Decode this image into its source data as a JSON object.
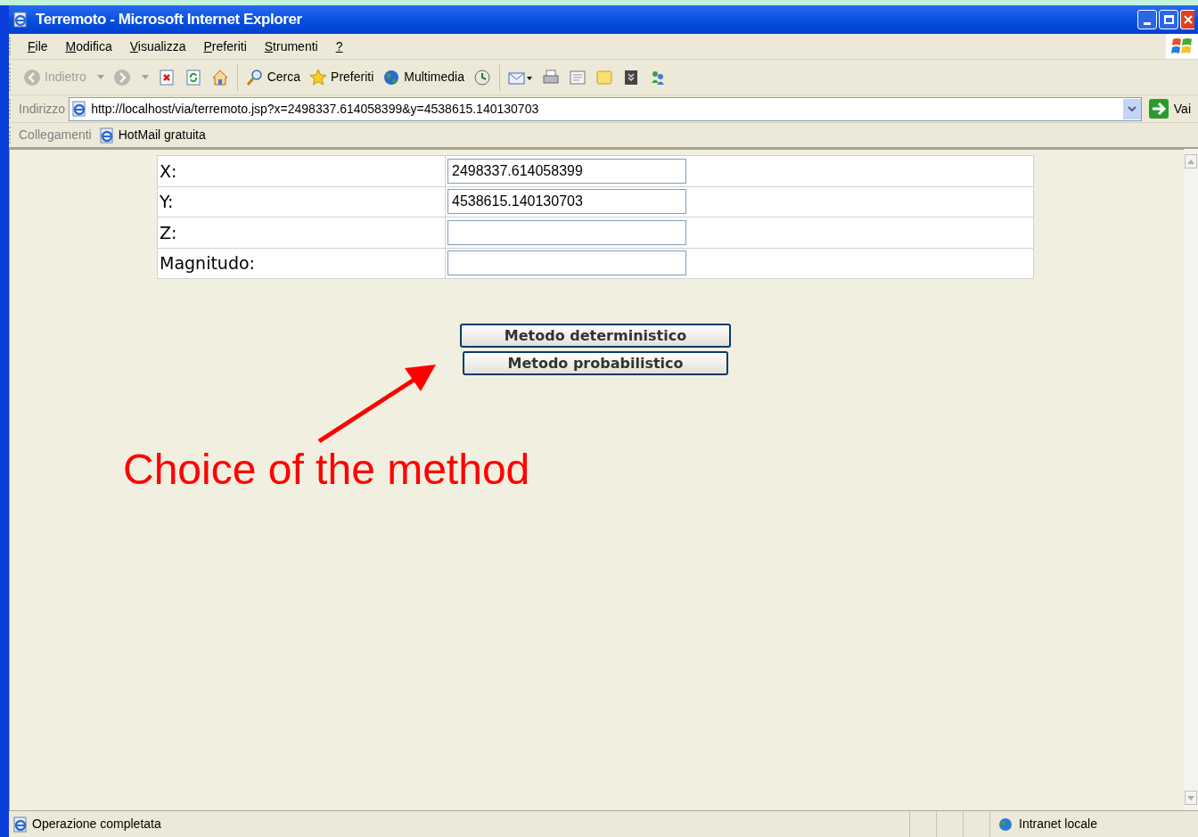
{
  "window": {
    "title": "Terremoto - Microsoft Internet Explorer"
  },
  "menu": [
    "File",
    "Modifica",
    "Visualizza",
    "Preferiti",
    "Strumenti",
    "?"
  ],
  "toolbar": [
    {
      "kind": "back",
      "label": "Indietro",
      "disabled": true
    },
    {
      "kind": "forward",
      "disabled": true
    },
    {
      "kind": "stop",
      "disabled": false
    },
    {
      "kind": "refresh",
      "disabled": false
    },
    {
      "kind": "home",
      "disabled": false
    },
    {
      "kind": "separator"
    },
    {
      "kind": "search",
      "label": "Cerca",
      "disabled": false
    },
    {
      "kind": "favorites",
      "label": "Preferiti",
      "disabled": false
    },
    {
      "kind": "media",
      "label": "Multimedia",
      "disabled": false
    },
    {
      "kind": "history",
      "disabled": false
    },
    {
      "kind": "separator"
    },
    {
      "kind": "mail",
      "disabled": false
    },
    {
      "kind": "print",
      "disabled": false
    },
    {
      "kind": "edit",
      "disabled": false
    },
    {
      "kind": "note",
      "disabled": false
    },
    {
      "kind": "research",
      "disabled": false
    },
    {
      "kind": "messenger",
      "disabled": false
    }
  ],
  "address": {
    "label": "Indirizzo",
    "url": "http://localhost/via/terremoto.jsp?x=2498337.614058399&y=4538615.140130703",
    "go": "Vai"
  },
  "links": {
    "label": "Collegamenti",
    "items": [
      "HotMail gratuita"
    ]
  },
  "form": {
    "fields": [
      {
        "label": "X:",
        "value": "2498337.614058399"
      },
      {
        "label": "Y:",
        "value": "4538615.140130703"
      },
      {
        "label": "Z:"
      },
      {
        "label": "Magnitudo:"
      }
    ]
  },
  "buttons": [
    "Metodo deterministico",
    "Metodo probabilistico"
  ],
  "annotation": {
    "text": "Choice of the method"
  },
  "status_bar": {
    "message": "Operazione completata",
    "zone": "Intranet locale"
  }
}
